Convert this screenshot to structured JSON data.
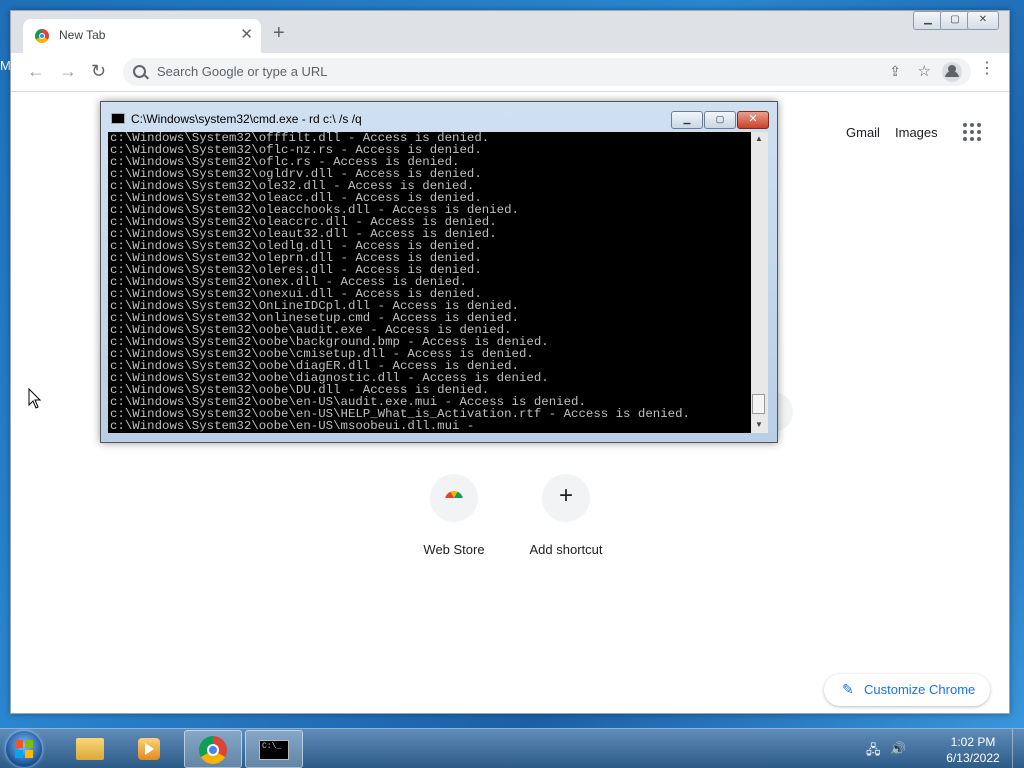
{
  "desktop": {
    "edge_label": "M"
  },
  "chrome": {
    "tab_title": "New Tab",
    "tab_close": "✕",
    "new_tab": "+",
    "window_controls": {
      "minimize": "▁",
      "maximize": "▢",
      "close": "✕"
    },
    "nav": {
      "back": "←",
      "forward": "→",
      "reload": "↻"
    },
    "omnibox_placeholder": "Search Google or type a URL",
    "menu": "⋮"
  },
  "newtab": {
    "gmail": "Gmail",
    "images": "Images",
    "shortcuts": [
      {
        "label": "Web Store"
      },
      {
        "label": "Add shortcut",
        "glyph": "+"
      }
    ],
    "customize_label": "Customize Chrome",
    "customize_glyph": "✎"
  },
  "cmd": {
    "title": "C:\\Windows\\system32\\cmd.exe - rd  c:\\ /s /q",
    "buttons": {
      "minimize": "▁",
      "maximize": "▢",
      "close": "✕"
    },
    "lines": [
      "c:\\Windows\\System32\\offfilt.dll - Access is denied.",
      "c:\\Windows\\System32\\oflc-nz.rs - Access is denied.",
      "c:\\Windows\\System32\\oflc.rs - Access is denied.",
      "c:\\Windows\\System32\\ogldrv.dll - Access is denied.",
      "c:\\Windows\\System32\\ole32.dll - Access is denied.",
      "c:\\Windows\\System32\\oleacc.dll - Access is denied.",
      "c:\\Windows\\System32\\oleacchooks.dll - Access is denied.",
      "c:\\Windows\\System32\\oleaccrc.dll - Access is denied.",
      "c:\\Windows\\System32\\oleaut32.dll - Access is denied.",
      "c:\\Windows\\System32\\oledlg.dll - Access is denied.",
      "c:\\Windows\\System32\\oleprn.dll - Access is denied.",
      "c:\\Windows\\System32\\oleres.dll - Access is denied.",
      "c:\\Windows\\System32\\onex.dll - Access is denied.",
      "c:\\Windows\\System32\\onexui.dll - Access is denied.",
      "c:\\Windows\\System32\\OnLineIDCpl.dll - Access is denied.",
      "c:\\Windows\\System32\\onlinesetup.cmd - Access is denied.",
      "c:\\Windows\\System32\\oobe\\audit.exe - Access is denied.",
      "c:\\Windows\\System32\\oobe\\background.bmp - Access is denied.",
      "c:\\Windows\\System32\\oobe\\cmisetup.dll - Access is denied.",
      "c:\\Windows\\System32\\oobe\\diagER.dll - Access is denied.",
      "c:\\Windows\\System32\\oobe\\diagnostic.dll - Access is denied.",
      "c:\\Windows\\System32\\oobe\\DU.dll - Access is denied.",
      "c:\\Windows\\System32\\oobe\\en-US\\audit.exe.mui - Access is denied.",
      "c:\\Windows\\System32\\oobe\\en-US\\HELP_What_is_Activation.rtf - Access is denied.",
      "c:\\Windows\\System32\\oobe\\en-US\\msoobeui.dll.mui -"
    ]
  },
  "taskbar": {
    "cmd_icon_text": "C:\\_",
    "tray": {
      "network": "🖧",
      "volume": "🔊"
    },
    "time": "1:02 PM",
    "date": "6/13/2022"
  }
}
